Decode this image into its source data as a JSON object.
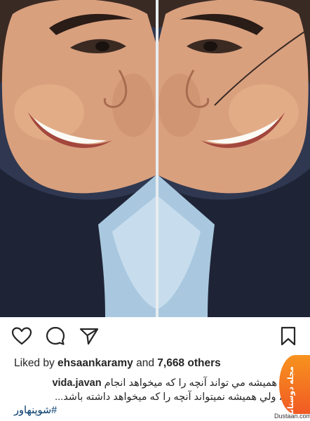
{
  "post": {
    "likes_by": "ehsaankaramy",
    "likes_mid": "and",
    "likes_count": "7,668 others",
    "likes_prefix": "Liked by",
    "username": "vida.javan",
    "caption_line1": "بشر همیشه مي تواند آنچه را که میخواهد انجام",
    "caption_line2": "دهد، ولي همیشه نمیتواند آنچه را که میخواهد داشته باشد...",
    "hashtag": "#شوپنهاور"
  },
  "actions": {
    "like_icon": "heart-icon",
    "comment_icon": "comment-icon",
    "share_icon": "paper-plane-icon",
    "save_icon": "bookmark-icon"
  },
  "watermark": {
    "badge_text": "مجله دوستانه",
    "site": "Dustaan.com"
  },
  "colors": {
    "hashtag": "#00376b",
    "text": "#262626",
    "watermark": "#f15a24"
  }
}
